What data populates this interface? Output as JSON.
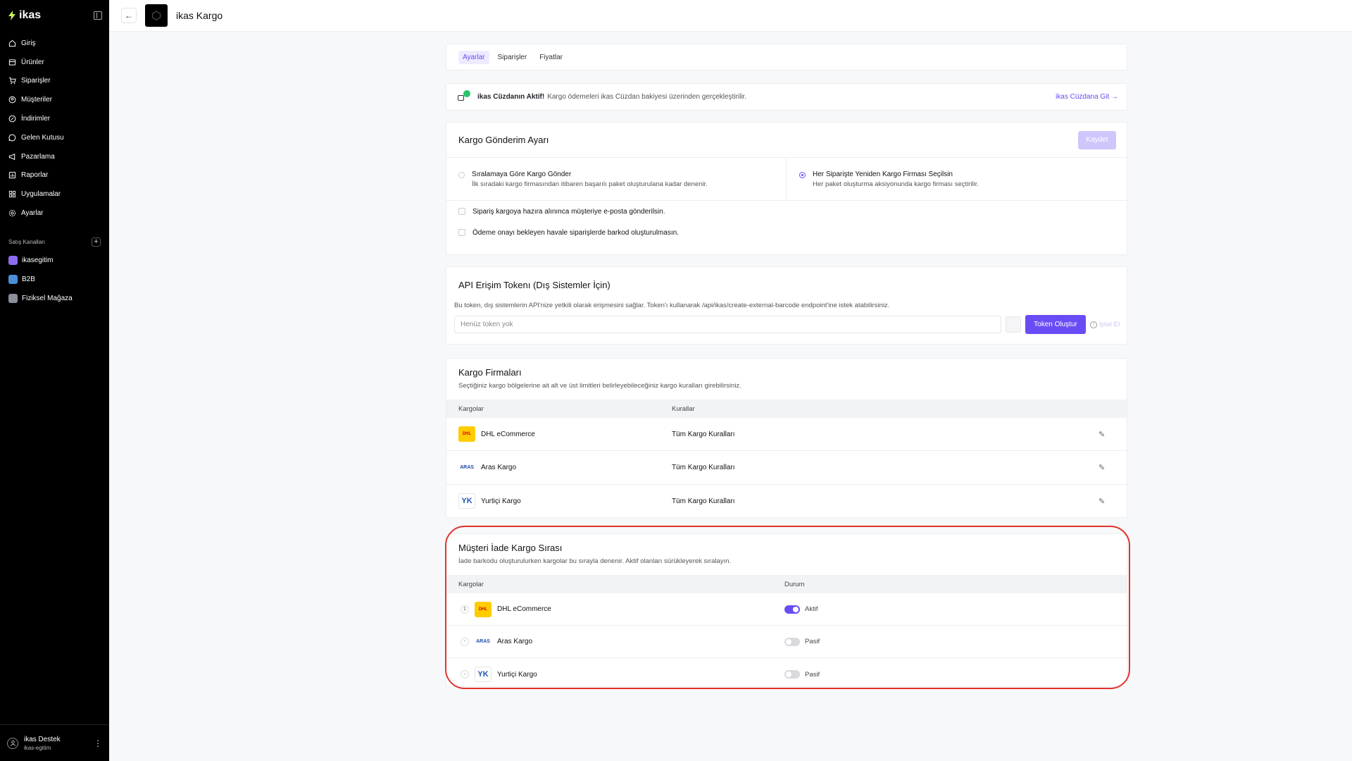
{
  "brand": {
    "name": "ikas"
  },
  "sidebar": {
    "items": [
      {
        "label": "Giriş",
        "icon": "home-icon"
      },
      {
        "label": "Ürünler",
        "icon": "box-icon"
      },
      {
        "label": "Siparişler",
        "icon": "cart-icon"
      },
      {
        "label": "Müşteriler",
        "icon": "users-icon"
      },
      {
        "label": "İndirimler",
        "icon": "discount-icon"
      },
      {
        "label": "Gelen Kutusu",
        "icon": "chat-icon"
      },
      {
        "label": "Pazarlama",
        "icon": "megaphone-icon"
      },
      {
        "label": "Raporlar",
        "icon": "chart-icon"
      },
      {
        "label": "Uygulamalar",
        "icon": "grid-icon"
      },
      {
        "label": "Ayarlar",
        "icon": "gear-icon"
      }
    ],
    "channels_title": "Satış Kanalları",
    "channels": [
      {
        "label": "ikasegitim",
        "color": "#8b6cf0"
      },
      {
        "label": "B2B",
        "color": "#4a90d9"
      },
      {
        "label": "Fiziksel Mağaza",
        "color": "#8a8f99"
      }
    ],
    "user": {
      "name": "ikas Destek",
      "store": "ikas-egitim"
    }
  },
  "header": {
    "title": "ikas Kargo"
  },
  "tabs": [
    {
      "label": "Ayarlar",
      "active": true
    },
    {
      "label": "Siparişler",
      "active": false
    },
    {
      "label": "Fiyatlar",
      "active": false
    }
  ],
  "wallet": {
    "bold": "ikas Cüzdanın Aktif!",
    "desc": "Kargo ödemeleri ikas Cüzdan bakiyesi üzerinden gerçekleştirilir.",
    "link": "ikas Cüzdana Git →"
  },
  "shipping": {
    "title": "Kargo Gönderim Ayarı",
    "save": "Kaydet",
    "option1_title": "Sıralamaya Göre Kargo Gönder",
    "option1_desc": "İlk sıradaki kargo firmasından itibaren başarılı paket oluşturulana kadar denenir.",
    "option2_title": "Her Siparişte Yeniden Kargo Firması Seçilsin",
    "option2_desc": "Her paket oluşturma aksiyonunda kargo firması seçtirilir.",
    "check1": "Sipariş kargoya hazıra alınınca müşteriye e-posta gönderilsin.",
    "check2": "Ödeme onayı bekleyen havale siparişlerde barkod oluşturulmasın."
  },
  "api": {
    "title": "API Erişim Tokenı (Dış Sistemler İçin)",
    "desc": "Bu token, dış sistemlerin API'nize yetkili olarak erişmesini sağlar. Token'ı kullanarak /api/ikas/create-external-barcode endpoint'ine istek atabilirsiniz.",
    "placeholder": "Henüz token yok",
    "create": "Token Oluştur",
    "cancel": "İptal Et"
  },
  "carriers": {
    "title": "Kargo Firmaları",
    "desc": "Seçtiğiniz kargo bölgelerine ait alt ve üst limitleri belirleyebileceğiniz kargo kuralları girebilirsiniz.",
    "col1": "Kargolar",
    "col2": "Kurallar",
    "rows": [
      {
        "name": "DHL eCommerce",
        "rule": "Tüm Kargo Kuralları",
        "logo_text": "DHL"
      },
      {
        "name": "Aras Kargo",
        "rule": "Tüm Kargo Kuralları",
        "logo_text": "ARAS"
      },
      {
        "name": "Yurtiçi Kargo",
        "rule": "Tüm Kargo Kuralları",
        "logo_text": "YK"
      }
    ]
  },
  "returns": {
    "title": "Müşteri İade Kargo Sırası",
    "desc": "İade barkodu oluşturulurken kargolar bu sırayla denenir. Aktif olanları sürükleyerek sıralayın.",
    "col1": "Kargolar",
    "col2": "Durum",
    "rows": [
      {
        "index": "1",
        "name": "DHL eCommerce",
        "status": "Aktif",
        "on": true,
        "logo_text": "DHL"
      },
      {
        "index": "-",
        "name": "Aras Kargo",
        "status": "Pasif",
        "on": false,
        "logo_text": "ARAS"
      },
      {
        "index": "-",
        "name": "Yurtiçi Kargo",
        "status": "Pasif",
        "on": false,
        "logo_text": "YK"
      }
    ]
  }
}
